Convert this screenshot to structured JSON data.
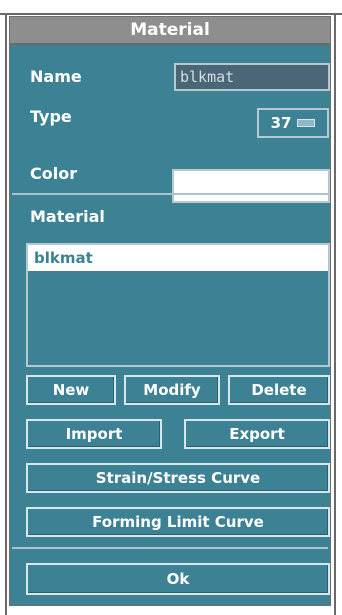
{
  "window": {
    "title": "Material"
  },
  "fields": {
    "name_label": "Name",
    "name_value": "blkmat",
    "type_label": "Type",
    "type_value": "37",
    "color_label": "Color",
    "color_value": "#ffffff"
  },
  "material_list": {
    "header": "Material",
    "items": [
      "blkmat"
    ],
    "selected": "blkmat"
  },
  "buttons": {
    "new": "New",
    "modify": "Modify",
    "delete": "Delete",
    "import": "Import",
    "export": "Export",
    "strain_stress": "Strain/Stress Curve",
    "forming_limit": "Forming Limit Curve",
    "ok": "Ok"
  },
  "colors": {
    "panel": "#3c8294",
    "titlebar": "#8e8e8e"
  }
}
